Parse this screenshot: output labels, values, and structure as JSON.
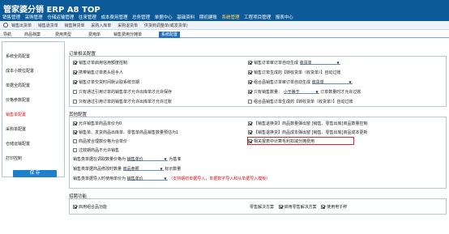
{
  "header": {
    "title": "管家婆分销 ERP A8 TOP",
    "menu": [
      "销售管理",
      "采购管理",
      "仓储运输管理",
      "往来管理",
      "成本费用管理",
      "总务管理",
      "单据中心",
      "基础资料",
      "期初建账",
      "系统管理",
      "工程项目管理",
      "报表中心"
    ],
    "active_menu": "系统管理"
  },
  "sub_toolbar": {
    "items": [
      "销售出货单",
      "销售退货单",
      "销售换货单",
      "采购入库单",
      "采购退货单",
      "供货商调整单(或发货单)"
    ]
  },
  "tabs": [
    "导航",
    "商品档案",
    "费用类型",
    "费用单",
    "销售费用分摊单",
    "系统配置"
  ],
  "active_tab": "系统配置",
  "left_menu": {
    "items": [
      "系统全局配置",
      "成本小数位配置",
      "单据全局配置",
      "价格参数配置",
      "销售单配置",
      "采购单配置",
      "仓储运输配置",
      "打印控制"
    ],
    "active": "销售单配置",
    "save_label": "保 存"
  },
  "section1": {
    "title": "订单相关配置",
    "left_rows": [
      {
        "checked": true,
        "label": "销售订单启用信用额度控制"
      },
      {
        "checked": true,
        "label": "携带销售订单表头经手人"
      },
      {
        "checked": true,
        "label": "销售订单交货时间默认取系统日期"
      },
      {
        "checked": false,
        "label": "只有通过引用订单的销售单才允许出库单才允许保存"
      },
      {
        "checked": false,
        "label": "只有通过引用订单的销售单才允许出库单才允许过账"
      }
    ],
    "right_rows": [
      {
        "checked": true,
        "label": "销售订单审订单自动生成",
        "select": "收货单"
      },
      {
        "checked": true,
        "label": "销售订单生成的【转收货单（收货单）】自动过账",
        "select": ""
      },
      {
        "checked": true,
        "label": "组合品销售订单审订单自动生成",
        "select": "收货单"
      },
      {
        "checked": true,
        "label": "只有销售数量：",
        "select": "小于等于",
        "suffix": "订单数量时才允许过账"
      },
      {
        "checked": false,
        "label": "组合品销售订单生成的【转收货单（收货单）】自动过账",
        "select": ""
      }
    ]
  },
  "section2": {
    "title": "其他配置",
    "left_rows": [
      {
        "checked": true,
        "label": "允许销售单商品单价为0"
      },
      {
        "checked": true,
        "label": "销售单、发货商品出库单、零售单商品销售数量预估为1"
      },
      {
        "checked": false,
        "label": "商品按合理数价格为合单价"
      },
      {
        "checked": false,
        "label": "过效期商品不允许销售"
      }
    ],
    "right_rows": [
      {
        "checked": true,
        "label": "【销售退换货】商品数量弹出窗 [销售、零售出库]商品数量控制"
      },
      {
        "checked": true,
        "label": "【销售退换货】商品成本弹出窗 [销售、零售出库]商品成本更新"
      },
      {
        "checked": true,
        "label": "相关报表中计算毛利扣减分摊费用",
        "highlight": true
      }
    ],
    "select_rows": [
      {
        "label": "销售类单据在调取数量价格为",
        "select": "销售单价",
        "suffix": "为基准"
      },
      {
        "label": "销售类单据商品修改时数量",
        "select": "商品参照",
        "suffix": "标示数量"
      },
      {
        "label": "销售类单据导入时使用单价为",
        "select": "销售单价",
        "suffix": "（支持期初单据导入，单据数字导入和从单据导入模板）"
      }
    ]
  },
  "section3": {
    "title": "招聘功能",
    "left_label": "启用组合品功能",
    "right_label": "零售解决方案",
    "right_options": [
      "启用零售解决方案",
      "使用电子秤"
    ]
  }
}
